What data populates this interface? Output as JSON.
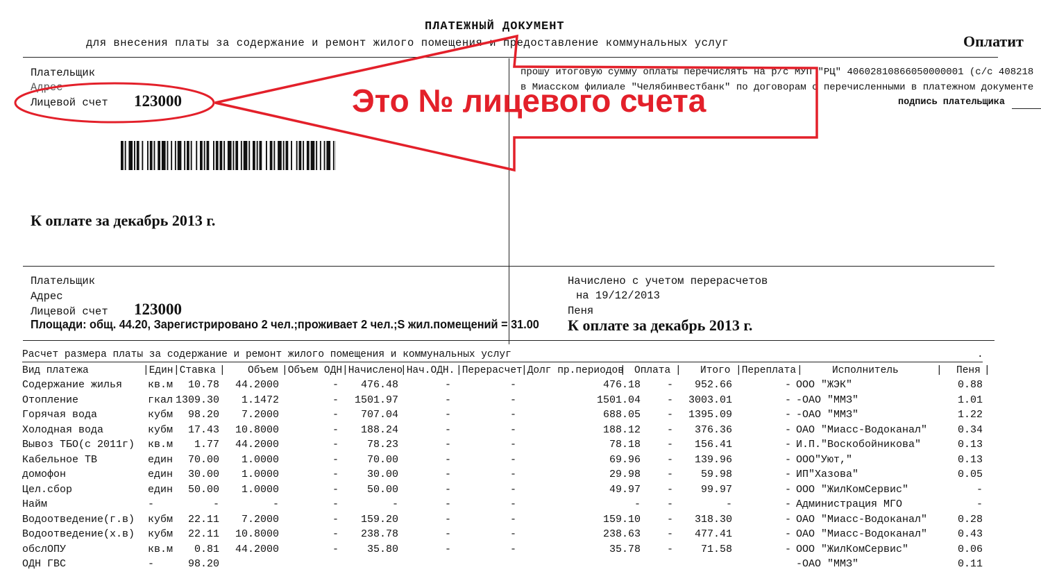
{
  "header": {
    "title": "ПЛАТЕЖНЫЙ ДОКУМЕНТ",
    "subtitle": "для внесения платы за содержание и ремонт жилого помещения и предоставление коммунальных услуг",
    "right_fragment": "Оплатит"
  },
  "top_left": {
    "payer_label": "Плательщик",
    "address_label": "Адрес",
    "account_label": "Лицевой счет",
    "account_number": "123000",
    "due_text": "К оплате за декабрь 2013 г."
  },
  "top_right": {
    "line1": "прошу итоговую сумму оплаты перечислять на р/с МУП \"РЦ\" 40602810866050000001 (с/с 408218",
    "line2": "в Миасском филиале \"Челябинвестбанк\" по договорам с перечисленными в платежном документе",
    "signature": "подпись плательщика"
  },
  "annotation": {
    "text": "Это № лицевого счета",
    "color": "#e3202a"
  },
  "middle_left": {
    "payer_label": "Плательщик",
    "address_label": "Адрес",
    "account_label": "Лицевой счет",
    "account_number": "123000",
    "areas": "Площади: общ. 44.20, Зарегистрировано 2 чел.;проживает 2 чел.;S жил.помещений = 31.00"
  },
  "middle_right": {
    "charged": "Начислено с учетом перерасчетов",
    "date": "на 19/12/2013",
    "penalty": "Пеня",
    "due_text": "К оплате за декабрь 2013 г."
  },
  "table": {
    "caption": "Расчет размера платы за содержание и ремонт жилого помещения и коммунальных услуг",
    "columns": [
      "Вид платежа",
      "|Един",
      "|Ставка",
      "|",
      "Объем",
      "|Объем ОДН",
      "|Начислено",
      "|Нач.ОДН.",
      "|Перерасчет",
      "|Долг пр.периодов",
      "|",
      "Оплата",
      "|",
      "Итого",
      "|Переплата",
      "|",
      "Исполнитель",
      "|",
      "Пеня",
      "|"
    ],
    "rows": [
      [
        "Содержание жилья",
        "кв.м",
        "10.78",
        "44.2000",
        "-",
        "476.48",
        "-",
        "-",
        "476.18",
        "-",
        "952.66",
        "-",
        "ООО \"ЖЭК\"",
        "0.88"
      ],
      [
        "Отопление",
        "гкал",
        "1309.30",
        "1.1472",
        "-",
        "1501.97",
        "-",
        "-",
        "1501.04",
        "-",
        "3003.01",
        "-",
        "-ОАО \"ММЗ\"",
        "1.01"
      ],
      [
        "Горячая вода",
        "кубм",
        "98.20",
        "7.2000",
        "-",
        "707.04",
        "-",
        "-",
        "688.05",
        "-",
        "1395.09",
        "-",
        "-ОАО \"ММЗ\"",
        "1.22"
      ],
      [
        "Холодная вода",
        "кубм",
        "17.43",
        "10.8000",
        "-",
        "188.24",
        "-",
        "-",
        "188.12",
        "-",
        "376.36",
        "-",
        "ОАО \"Миасс-Водоканал\"",
        "0.34"
      ],
      [
        "Вывоз ТБО(с 2011г)",
        "кв.м",
        "1.77",
        "44.2000",
        "-",
        "78.23",
        "-",
        "-",
        "78.18",
        "-",
        "156.41",
        "-",
        "И.П.\"Воскобойникова\"",
        "0.13"
      ],
      [
        "Кабельное ТВ",
        "един",
        "70.00",
        "1.0000",
        "-",
        "70.00",
        "-",
        "-",
        "69.96",
        "-",
        "139.96",
        "-",
        "ООО\"Уют,\"",
        "0.13"
      ],
      [
        "домофон",
        "един",
        "30.00",
        "1.0000",
        "-",
        "30.00",
        "-",
        "-",
        "29.98",
        "-",
        "59.98",
        "-",
        "ИП\"Хазова\"",
        "0.05"
      ],
      [
        "Цел.сбор",
        "един",
        "50.00",
        "1.0000",
        "-",
        "50.00",
        "-",
        "-",
        "49.97",
        "-",
        "99.97",
        "-",
        "ООО \"ЖилКомСервис\"",
        "-"
      ],
      [
        "Найм",
        "-",
        "-",
        "-",
        "-",
        "-",
        "-",
        "-",
        "-",
        "-",
        "-",
        "-",
        "Администрация МГО",
        "-"
      ],
      [
        "Водоотведение(г.в)",
        "кубм",
        "22.11",
        "7.2000",
        "-",
        "159.20",
        "-",
        "-",
        "159.10",
        "-",
        "318.30",
        "-",
        "ОАО \"Миасс-Водоканал\"",
        "0.28"
      ],
      [
        "Водоотведение(х.в)",
        "кубм",
        "22.11",
        "10.8000",
        "-",
        "238.78",
        "-",
        "-",
        "238.63",
        "-",
        "477.41",
        "-",
        "ОАО \"Миасс-Водоканал\"",
        "0.43"
      ],
      [
        "обслОПУ",
        "кв.м",
        "0.81",
        "44.2000",
        "-",
        "35.80",
        "-",
        "-",
        "35.78",
        "-",
        "71.58",
        "-",
        "ООО \"ЖилКомСервис\"",
        "0.06"
      ],
      [
        "ОДН ГВС",
        "-",
        "98.20",
        "",
        "",
        "",
        "",
        "",
        "",
        "",
        "",
        "",
        "-ОАО \"ММЗ\"",
        "0.11"
      ]
    ]
  }
}
